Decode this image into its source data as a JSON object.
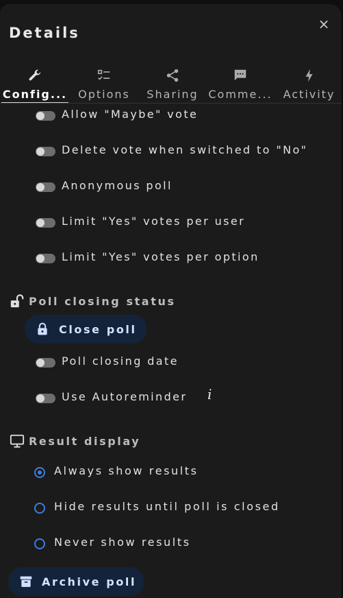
{
  "panel": {
    "title": "Details",
    "close_glyph": "×"
  },
  "tabs": [
    {
      "label": "Config...",
      "icon": "wrench-icon",
      "active": true
    },
    {
      "label": "Options",
      "icon": "checklist-icon"
    },
    {
      "label": "Sharing",
      "icon": "share-icon"
    },
    {
      "label": "Comme...",
      "icon": "comment-icon"
    },
    {
      "label": "Activity",
      "icon": "lightning-icon"
    }
  ],
  "vote_toggles": [
    {
      "label": "Allow \"Maybe\" vote",
      "on": false
    },
    {
      "label": "Delete vote when switched to \"No\"",
      "on": false
    },
    {
      "label": "Anonymous poll",
      "on": false
    },
    {
      "label": "Limit \"Yes\" votes per user",
      "on": false
    },
    {
      "label": "Limit \"Yes\" votes per option",
      "on": false
    }
  ],
  "closing": {
    "heading": "Poll closing status",
    "heading_icon": "unlocked-padlock-icon",
    "close_button": {
      "label": "Close poll",
      "icon": "padlock-icon"
    },
    "toggles": [
      {
        "label": "Poll closing date",
        "on": false
      },
      {
        "label": "Use Autoreminder",
        "on": false,
        "info_glyph": "i"
      }
    ]
  },
  "results": {
    "heading": "Result display",
    "heading_icon": "monitor-icon",
    "options": [
      {
        "label": "Always show results",
        "checked": true
      },
      {
        "label": "Hide results until poll is closed",
        "checked": false
      },
      {
        "label": "Never show results",
        "checked": false
      }
    ]
  },
  "archive_button": {
    "label": "Archive poll",
    "icon": "archive-icon"
  },
  "colors": {
    "accent": "#3d7de0",
    "button_bg": "#13233a",
    "panel_bg": "#1b1b1b"
  }
}
